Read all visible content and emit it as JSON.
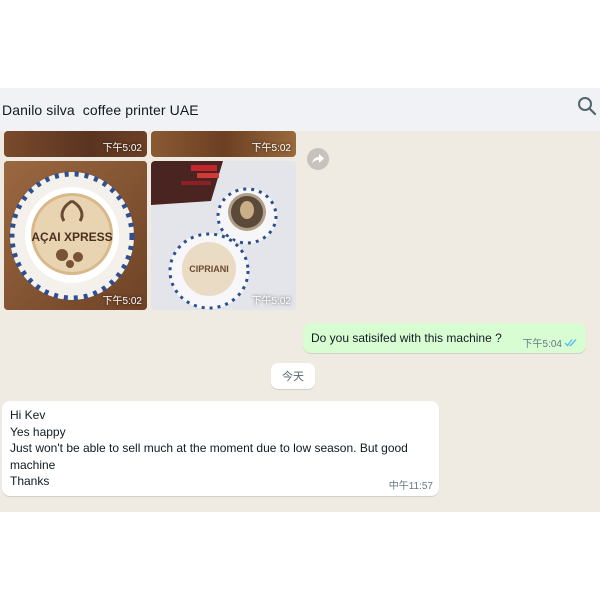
{
  "header": {
    "title": "Danilo silva  coffee printer UAE",
    "search_icon": "search-icon"
  },
  "photos": {
    "top_left_time": "下午5:02",
    "top_right_time": "下午5:02",
    "bottom_left_time": "下午5:02",
    "bottom_right_time": "下午5:02",
    "bottom_left_latte_text": "AÇAI XPRESS",
    "bottom_right_latte_text": "CIPRIANI"
  },
  "outgoing_message": {
    "text": "Do you satisifed with this machine ?",
    "time": "下午5:04",
    "status_icon": "double-check-icon",
    "status_color": "#53bdeb"
  },
  "day_divider": {
    "label": "今天"
  },
  "incoming_message": {
    "lines": [
      "Hi Kev",
      "Yes happy",
      "Just won't be able to sell much at the moment due to low season. But good machine",
      "Thanks"
    ],
    "time": "中午11:57"
  },
  "colors": {
    "chat_bg": "#efeae2",
    "header_bg": "#f0f2f5",
    "outgoing_bubble": "#d9fdd3",
    "incoming_bubble": "#ffffff"
  }
}
